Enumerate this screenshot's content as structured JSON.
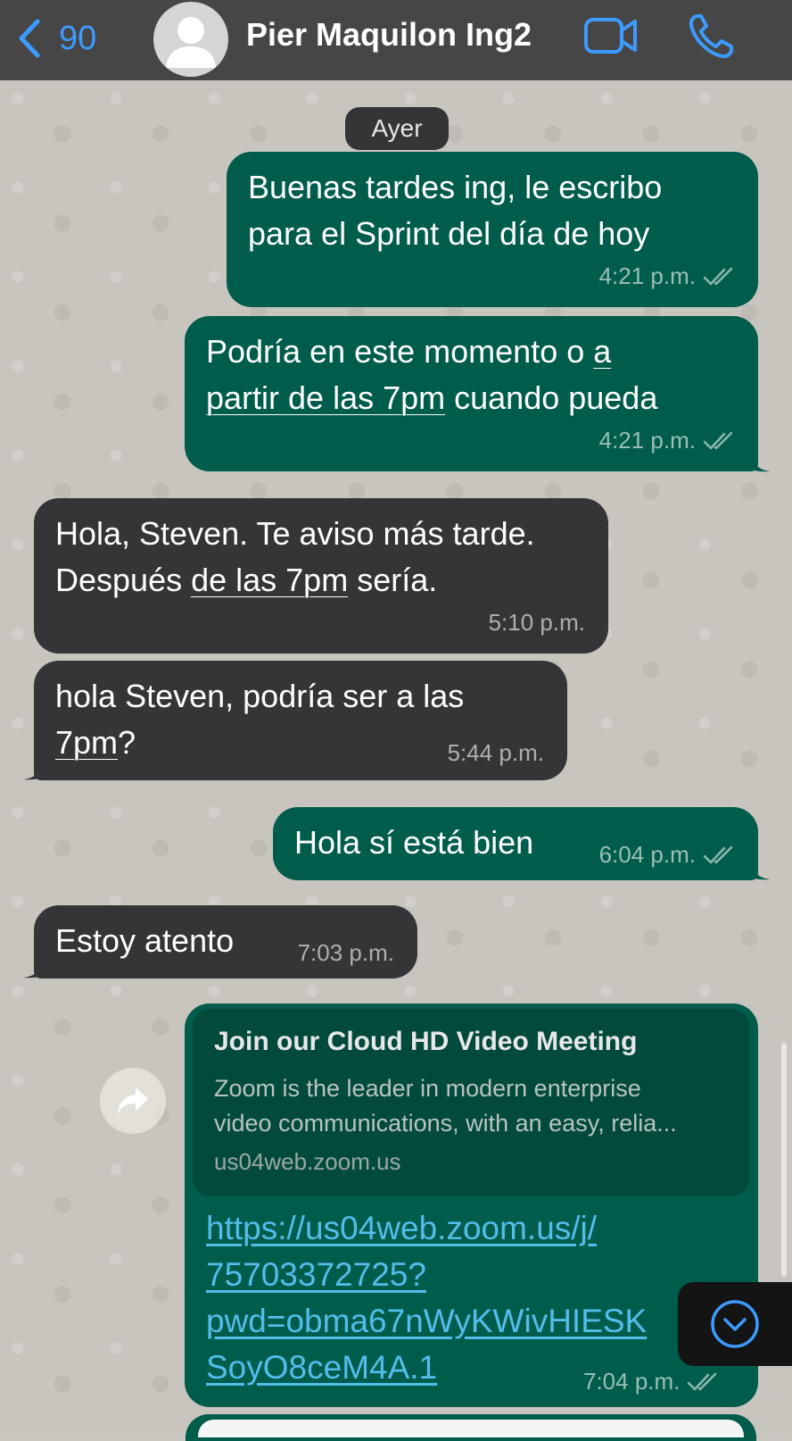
{
  "header": {
    "back_count": "90",
    "contact_name": "Pier Maquilon Ing2"
  },
  "date_chip": "Ayer",
  "messages": [
    {
      "dir": "out",
      "lines": [
        "Buenas tardes ing, le escribo",
        "para el Sprint del día de hoy"
      ],
      "time": "4:21 p.m.",
      "status": "read"
    },
    {
      "dir": "out",
      "line1_before": "Podría en este momento o ",
      "line1_link": "a",
      "line2_link": "partir de las 7pm",
      "line2_after": " cuando pueda",
      "time": "4:21 p.m.",
      "status": "read"
    },
    {
      "dir": "in",
      "line1": "Hola, Steven. Te aviso más tarde.",
      "line2_before": "Después ",
      "line2_link": "de las 7pm",
      "line2_after": " sería.",
      "time": "5:10 p.m."
    },
    {
      "dir": "in",
      "line1": "hola Steven, podría ser a las",
      "line2_link": "7pm",
      "line2_after": "?",
      "time": "5:44 p.m."
    },
    {
      "dir": "out",
      "text": "Hola sí está bien",
      "time": "6:04 p.m.",
      "status": "read"
    },
    {
      "dir": "in",
      "text": "Estoy atento",
      "time": "7:03 p.m."
    },
    {
      "dir": "out",
      "preview": {
        "title": "Join our Cloud HD Video Meeting",
        "desc1": "Zoom is the leader in modern enterprise",
        "desc2": "video communications, with an easy, relia...",
        "domain": "us04web.zoom.us"
      },
      "link_lines": [
        "https://us04web.zoom.us/j/",
        "75703372725?",
        "pwd=obma67nWyKWivHIESK",
        "SoyO8ceM4A.1"
      ],
      "time": "7:04 p.m.",
      "status": "read"
    }
  ],
  "colors": {
    "outgoing": "#005c4b",
    "incoming": "#353537",
    "header": "#464646",
    "accent": "#3d9bff",
    "link": "#53bdeb"
  },
  "icons": [
    "chevron-left-icon",
    "avatar-placeholder-icon",
    "video-call-icon",
    "phone-icon",
    "double-check-icon",
    "forward-icon",
    "chevron-down-icon"
  ]
}
